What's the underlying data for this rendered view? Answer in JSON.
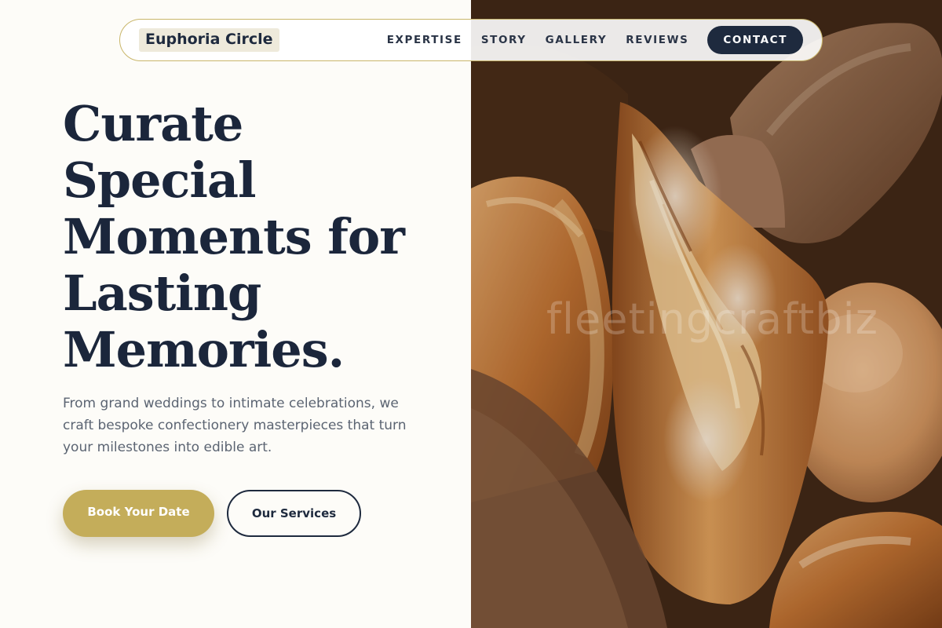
{
  "nav": {
    "logo": "Euphoria Circle",
    "links": [
      "EXPERTISE",
      "STORY",
      "GALLERY",
      "REVIEWS"
    ],
    "cta": "CONTACT"
  },
  "hero": {
    "headline_lines": [
      "Curate",
      "Special",
      "Moments for",
      "Lasting",
      "Memories."
    ],
    "subtext": "From grand weddings to intimate celebrations, we craft bespoke confectionery masterpieces that turn your milestones into edible art.",
    "primary_button": "Book Your Date",
    "secondary_button": "Our Services"
  },
  "photo": {
    "subject": "bread-loaves-image",
    "watermark": "fleetingcraftbiz"
  },
  "colors": {
    "navy": "#1e2a3e",
    "gold": "#c4ad5a",
    "cream": "#fdfcf8",
    "nav_border": "#c9b66a"
  }
}
